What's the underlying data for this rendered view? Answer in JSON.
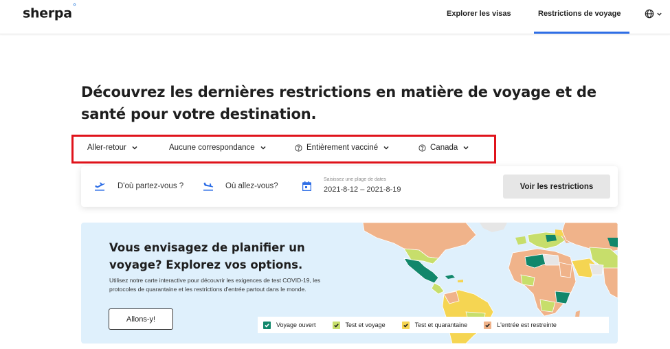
{
  "header": {
    "logo": "sherpa",
    "logo_mark": "°",
    "nav": [
      {
        "label": "Explorer les visas"
      },
      {
        "label": "Restrictions de voyage",
        "active": true
      }
    ],
    "language_icon": "globe-icon"
  },
  "headline": "Découvrez les dernières restrictions en matière de voyage et de santé pour votre destination.",
  "filters": {
    "trip_type": "Aller-retour",
    "connection": "Aucune correspondance",
    "vaccination": "Entièrement vacciné",
    "country": "Canada"
  },
  "search": {
    "origin_placeholder": "D'où partez-vous ?",
    "destination_placeholder": "Où allez-vous?",
    "date_label": "Saisissez une plage de dates",
    "date_value": "2021-8-12 – 2021-8-19",
    "button": "Voir les restrictions"
  },
  "promo": {
    "title": "Vous envisagez de planifier un voyage? Explorez vos options.",
    "description": "Utilisez notre carte interactive pour découvrir les exigences de test COVID-19, les protocoles de quarantaine et les restrictions d'entrée partout dans le monde.",
    "button": "Allons-y!",
    "legend": [
      {
        "label": "Voyage ouvert",
        "color": "#11876b"
      },
      {
        "label": "Test et voyage",
        "color": "#c7de6b"
      },
      {
        "label": "Test et quarantaine",
        "color": "#f5d552"
      },
      {
        "label": "L'entrée est restreinte",
        "color": "#f0b38a"
      }
    ]
  },
  "colors": {
    "accent": "#2e6ee6",
    "highlight_box": "#e0131b",
    "promo_bg": "#dff0fc"
  }
}
